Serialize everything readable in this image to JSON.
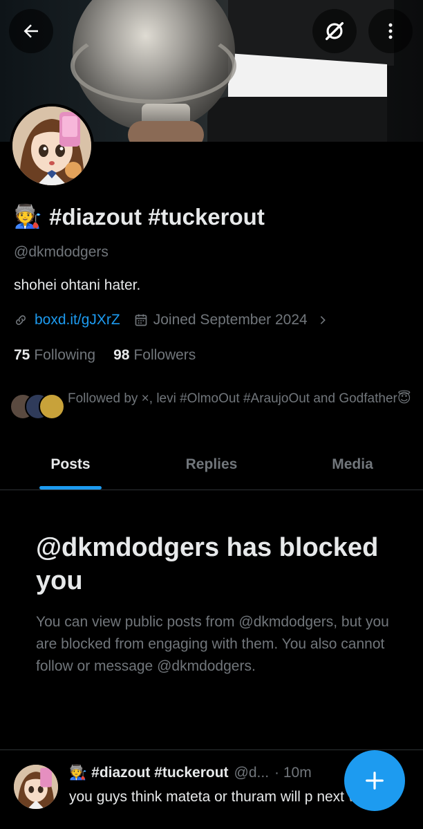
{
  "header": {
    "back_icon": "arrow-left-icon",
    "grok_icon": "grok-icon",
    "more_icon": "more-vertical-icon"
  },
  "profile": {
    "display_name_emoji": "🧑‍🏭",
    "display_name": "#diazout #tuckerout",
    "handle": "@dkmdodgers",
    "bio": "shohei ohtani hater.",
    "link": "boxd.it/gJXrZ",
    "joined": "Joined September 2024",
    "following_count": "75",
    "following_label": "Following",
    "followers_count": "98",
    "followers_label": "Followers",
    "followed_by": "Followed by ×, levi #OlmoOut #AraujoOut and Godfather😇"
  },
  "tabs": [
    {
      "label": "Posts",
      "active": true
    },
    {
      "label": "Replies",
      "active": false
    },
    {
      "label": "Media",
      "active": false
    }
  ],
  "blocked": {
    "title": "@dkmdodgers has blocked you",
    "description": "You can view public posts from @dkmdodgers, but you are blocked from engaging with them. You also cannot follow or message @dkmdodgers."
  },
  "post": {
    "emoji": "🧑‍🏭",
    "name": "#diazout #tuckerout",
    "handle": "@d...",
    "time": "· 10m",
    "text": "you guys think mateta or thuram will p next wc lol"
  },
  "colors": {
    "accent": "#1d9bf0",
    "muted": "#71767b",
    "text": "#e7e9ea",
    "background": "#000000"
  }
}
